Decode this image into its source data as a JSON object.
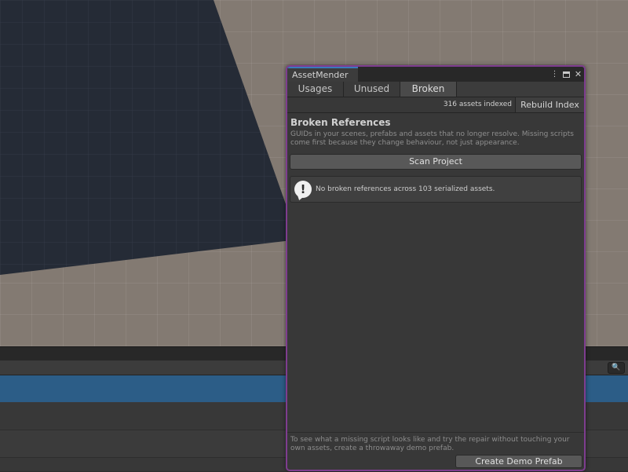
{
  "window": {
    "title": "AssetMender",
    "accent_color": "#7e3d8f",
    "controls": [
      "more-icon",
      "maximize-icon",
      "close-icon"
    ],
    "close_glyph": "✕",
    "more_glyph": "⋮"
  },
  "tabs": [
    {
      "label": "Usages",
      "active": false
    },
    {
      "label": "Unused",
      "active": false
    },
    {
      "label": "Broken",
      "active": true
    }
  ],
  "index_bar": {
    "count_text": "316 assets indexed",
    "rebuild_label": "Rebuild Index"
  },
  "broken": {
    "title": "Broken References",
    "description": "GUIDs in your scenes, prefabs and assets that no longer resolve. Missing scripts come first because they change behaviour, not just appearance.",
    "scan_label": "Scan Project",
    "result_icon": "exclamation-icon",
    "result_glyph": "!",
    "result_text": "No broken references across 103 serialized assets."
  },
  "footer": {
    "text": "To see what a missing script looks like and try the repair without touching your own assets, create a throwaway demo prefab.",
    "demo_label": "Create Demo Prefab"
  },
  "dock": {
    "search_icon": "search-icon",
    "search_glyph": "🔍",
    "selected_row_color": "#2c5d87"
  }
}
